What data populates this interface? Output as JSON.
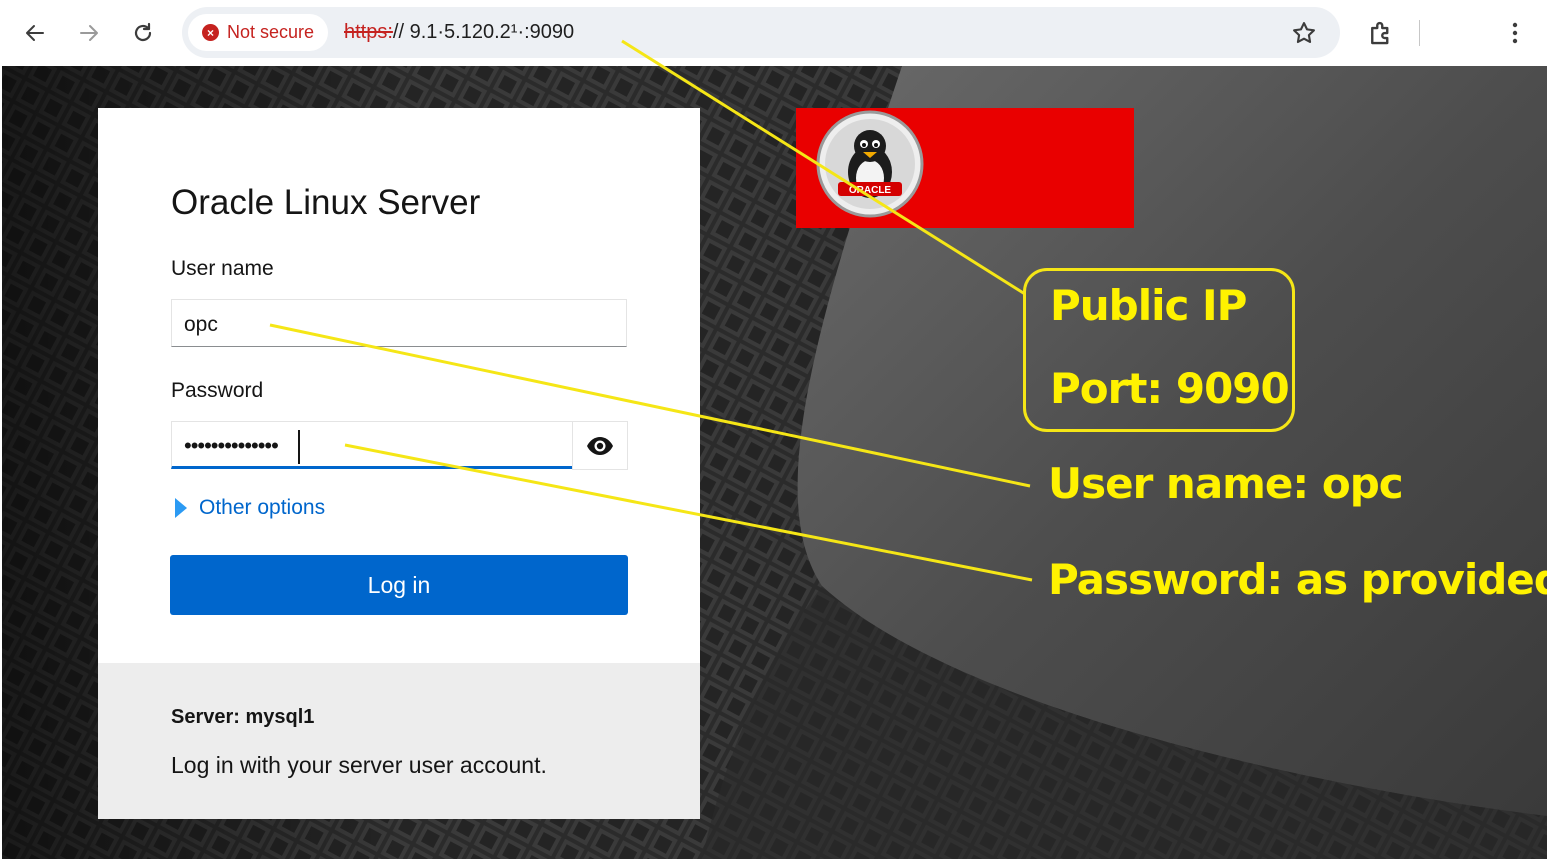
{
  "browser": {
    "security_label": "Not secure",
    "url_scheme": "https:",
    "url_rest": "// 9.1·5.120.2¹·:9090"
  },
  "login": {
    "title": "Oracle Linux Server",
    "username_label": "User name",
    "username_value": "opc",
    "password_label": "Password",
    "password_mask": "••••••••••••••",
    "other_options": "Other options",
    "login_button": "Log in",
    "server_line": "Server: mysql1",
    "help_text": "Log in with your server user account."
  },
  "brand": {
    "logo_text": "ORACLE"
  },
  "annotations": {
    "public_ip": "Public IP",
    "port": "Port: 9090",
    "user_name": "User name: opc",
    "password": "Password: as provided"
  },
  "colors": {
    "annotation": "#fff200",
    "primary_button": "#0066cc",
    "brand_red": "#e90000",
    "insecure_red": "#c5221f"
  }
}
